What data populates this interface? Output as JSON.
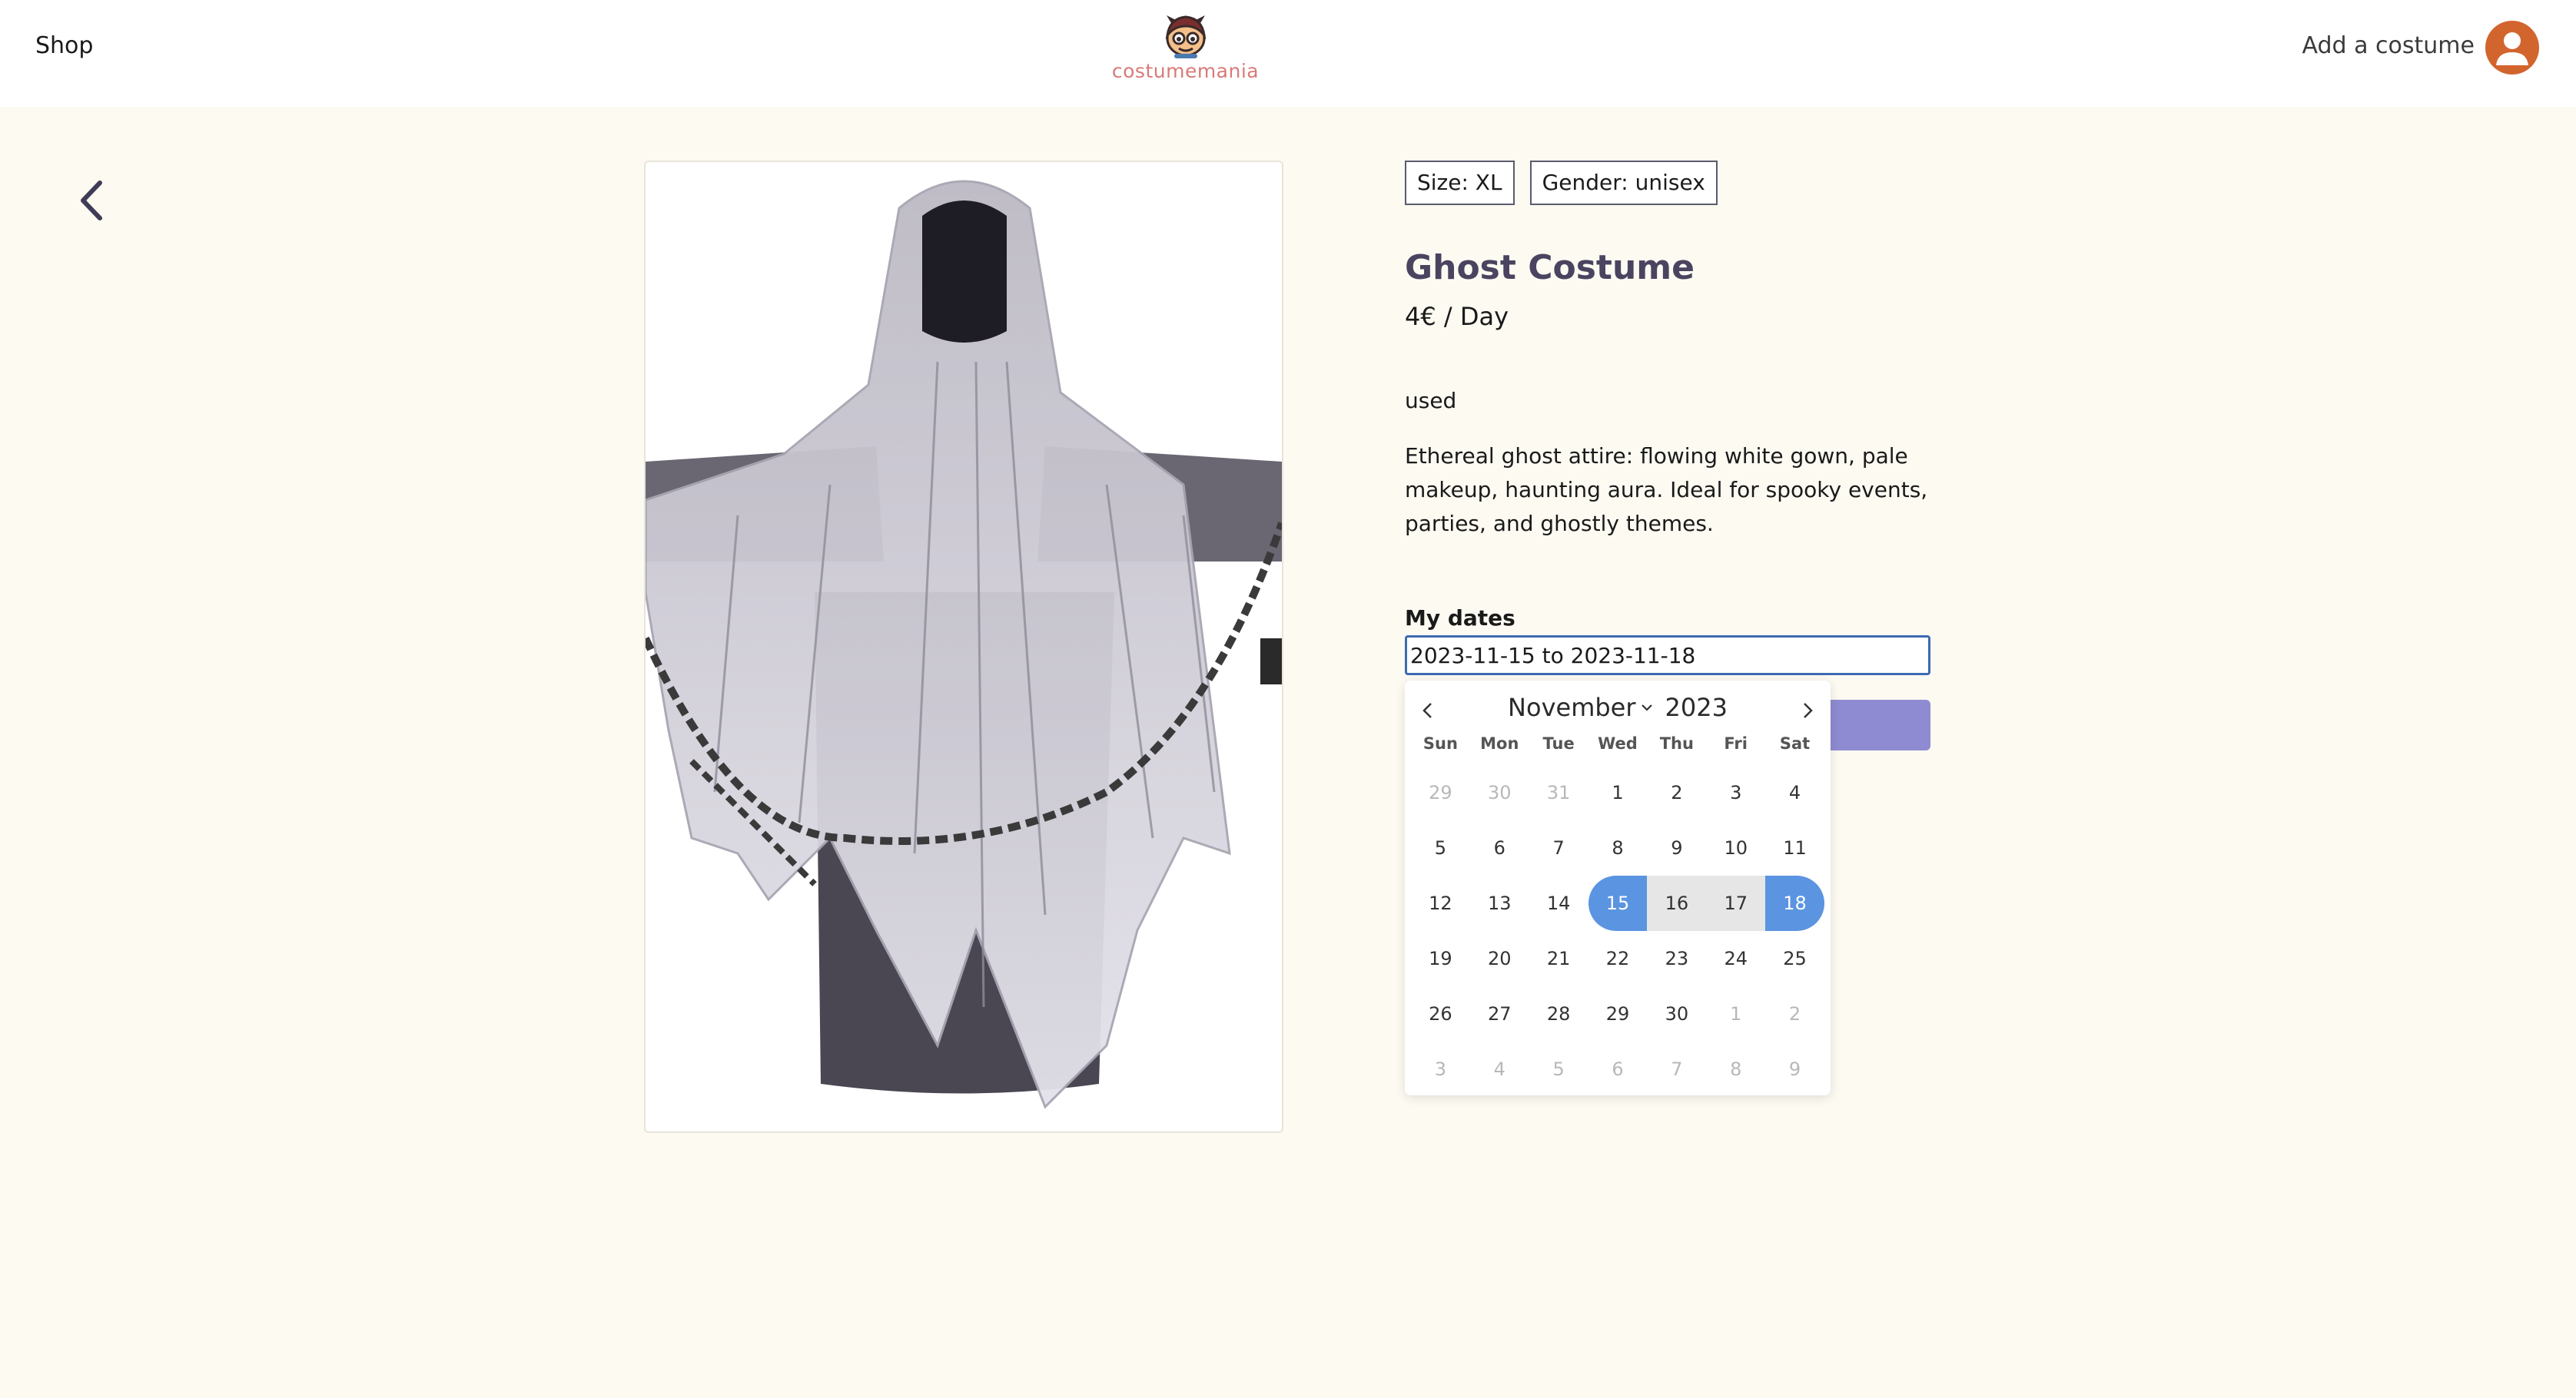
{
  "nav": {
    "shop_label": "Shop",
    "add_costume_label": "Add a costume"
  },
  "logo": {
    "text": "costumemania"
  },
  "product": {
    "tags": [
      "Size: XL",
      "Gender: unisex"
    ],
    "title": "Ghost Costume",
    "price": "4€ / Day",
    "condition": "used",
    "description": "Ethereal ghost attire: flowing white gown, pale makeup, haunting aura. Ideal for spooky events, parties, and ghostly themes."
  },
  "booking": {
    "label": "My dates",
    "value": "2023-11-15 to 2023-11-18"
  },
  "calendar": {
    "month": "November",
    "year": "2023",
    "weekdays": [
      "Sun",
      "Mon",
      "Tue",
      "Wed",
      "Thu",
      "Fri",
      "Sat"
    ],
    "days": [
      {
        "d": "29",
        "s": "muted"
      },
      {
        "d": "30",
        "s": "muted"
      },
      {
        "d": "31",
        "s": "muted"
      },
      {
        "d": "1",
        "s": ""
      },
      {
        "d": "2",
        "s": ""
      },
      {
        "d": "3",
        "s": ""
      },
      {
        "d": "4",
        "s": ""
      },
      {
        "d": "5",
        "s": ""
      },
      {
        "d": "6",
        "s": ""
      },
      {
        "d": "7",
        "s": ""
      },
      {
        "d": "8",
        "s": ""
      },
      {
        "d": "9",
        "s": ""
      },
      {
        "d": "10",
        "s": ""
      },
      {
        "d": "11",
        "s": ""
      },
      {
        "d": "12",
        "s": ""
      },
      {
        "d": "13",
        "s": ""
      },
      {
        "d": "14",
        "s": ""
      },
      {
        "d": "15",
        "s": "start"
      },
      {
        "d": "16",
        "s": "inrange"
      },
      {
        "d": "17",
        "s": "inrange"
      },
      {
        "d": "18",
        "s": "end"
      },
      {
        "d": "19",
        "s": ""
      },
      {
        "d": "20",
        "s": ""
      },
      {
        "d": "21",
        "s": ""
      },
      {
        "d": "22",
        "s": ""
      },
      {
        "d": "23",
        "s": ""
      },
      {
        "d": "24",
        "s": ""
      },
      {
        "d": "25",
        "s": ""
      },
      {
        "d": "26",
        "s": ""
      },
      {
        "d": "27",
        "s": ""
      },
      {
        "d": "28",
        "s": ""
      },
      {
        "d": "29",
        "s": ""
      },
      {
        "d": "30",
        "s": ""
      },
      {
        "d": "1",
        "s": "muted"
      },
      {
        "d": "2",
        "s": "muted"
      },
      {
        "d": "3",
        "s": "muted"
      },
      {
        "d": "4",
        "s": "muted"
      },
      {
        "d": "5",
        "s": "muted"
      },
      {
        "d": "6",
        "s": "muted"
      },
      {
        "d": "7",
        "s": "muted"
      },
      {
        "d": "8",
        "s": "muted"
      },
      {
        "d": "9",
        "s": "muted"
      }
    ]
  },
  "icons": {
    "back": "chevron-left-icon",
    "avatar": "user-icon",
    "prev": "chevron-left-icon",
    "next": "chevron-right-icon",
    "month_dropdown": "chevron-down-icon"
  },
  "colors": {
    "page_bg": "#fdfaf2",
    "title": "#4a4460",
    "avatar": "#d2642e",
    "button": "#8f8bd2",
    "range_endpoint": "#5b94e0",
    "input_border": "#3d6bb3",
    "logo_text": "#d97a7a"
  }
}
